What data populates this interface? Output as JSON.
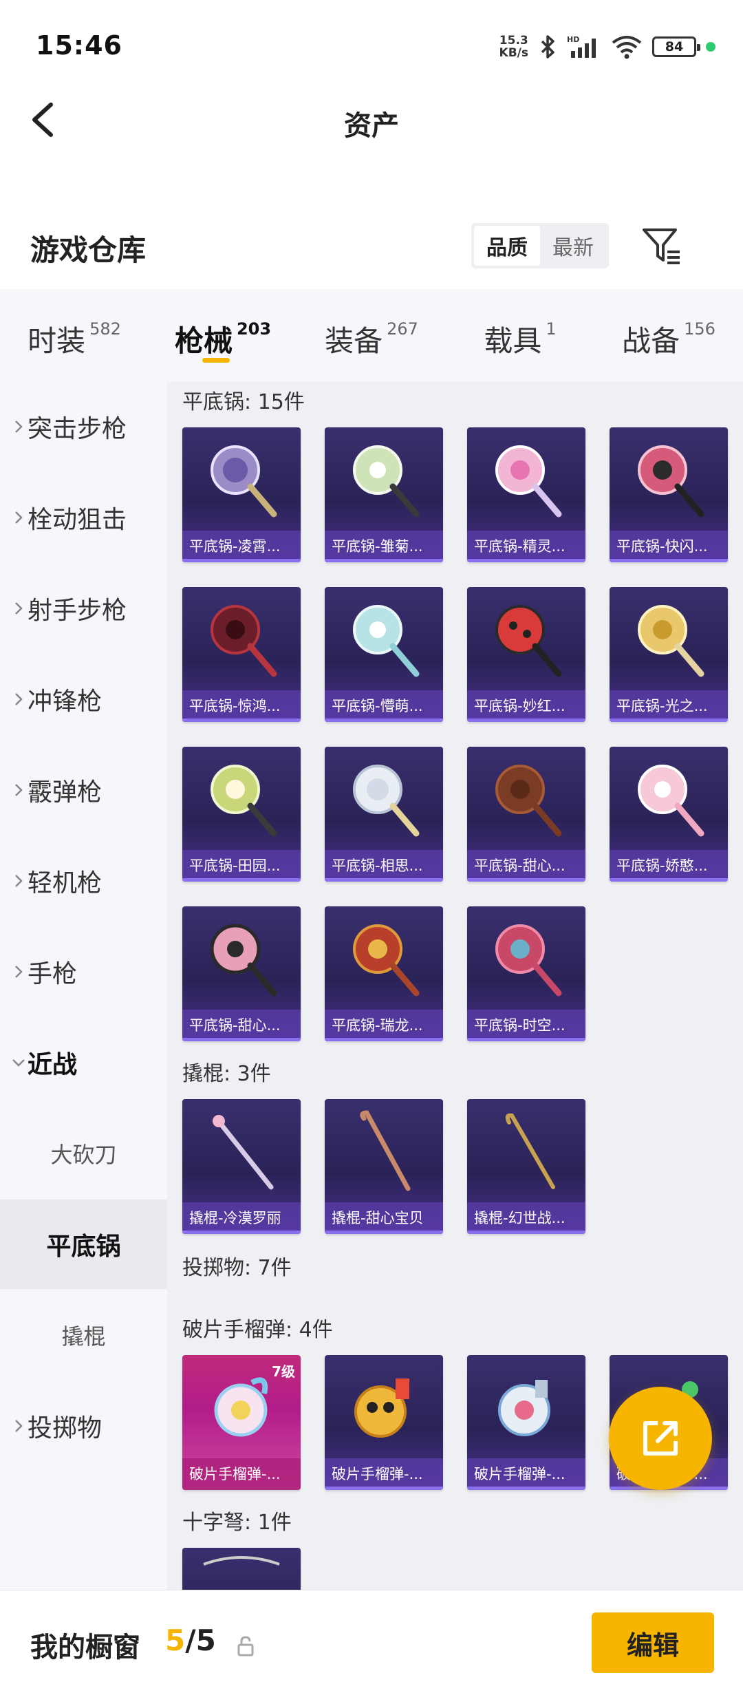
{
  "status_bar": {
    "time": "15:46",
    "net_speed_value": "15.3",
    "net_speed_unit": "KB/s",
    "battery": "84"
  },
  "header": {
    "title": "资产"
  },
  "warehouse": {
    "title": "游戏仓库",
    "sort_options": [
      "品质",
      "最新"
    ],
    "selected_sort": "品质"
  },
  "tabs": [
    {
      "label": "时装",
      "count": "582"
    },
    {
      "label": "枪械",
      "count": "203",
      "active": true
    },
    {
      "label": "装备",
      "count": "267"
    },
    {
      "label": "载具",
      "count": "1"
    },
    {
      "label": "战备",
      "count": "156"
    }
  ],
  "sidebar": {
    "items": [
      {
        "label": "突击步枪"
      },
      {
        "label": "栓动狙击"
      },
      {
        "label": "射手步枪"
      },
      {
        "label": "冲锋枪"
      },
      {
        "label": "霰弹枪"
      },
      {
        "label": "轻机枪"
      },
      {
        "label": "手枪"
      },
      {
        "label": "近战"
      },
      {
        "label": "投掷物"
      }
    ],
    "sub_items": [
      {
        "label": "大砍刀"
      },
      {
        "label": "平底锅"
      },
      {
        "label": "撬棍"
      }
    ],
    "selected": "平底锅"
  },
  "sections": {
    "pan": {
      "title": "平底锅: 15件",
      "items": [
        "平底锅-凌霄...",
        "平底锅-雏菊...",
        "平底锅-精灵...",
        "平底锅-快闪...",
        "平底锅-惊鸿...",
        "平底锅-懵萌...",
        "平底锅-妙红...",
        "平底锅-光之...",
        "平底锅-田园...",
        "平底锅-相思...",
        "平底锅-甜心...",
        "平底锅-娇憨...",
        "平底锅-甜心...",
        "平底锅-瑞龙...",
        "平底锅-时空..."
      ]
    },
    "crowbar": {
      "title": "撬棍: 3件",
      "items": [
        "撬棍-冷漠罗丽",
        "撬棍-甜心宝贝",
        "撬棍-幻世战..."
      ]
    },
    "throwable": {
      "title": "投掷物: 7件"
    },
    "frag": {
      "title": "破片手榴弹: 4件",
      "items": [
        "破片手榴弹-...",
        "破片手榴弹-...",
        "破片手榴弹-...",
        "破片手榴弹-..."
      ],
      "first_badge": "7级"
    },
    "crossbow": {
      "title": "十字弩: 1件"
    }
  },
  "bottom_bar": {
    "label": "我的橱窗",
    "count_current": "5",
    "count_total": "/5",
    "edit_label": "编辑"
  },
  "colors": {
    "accent": "#f7b500",
    "card_bg": "#2a2357",
    "card_label": "#5a3caa",
    "highlight_card": "#c02a7a"
  }
}
